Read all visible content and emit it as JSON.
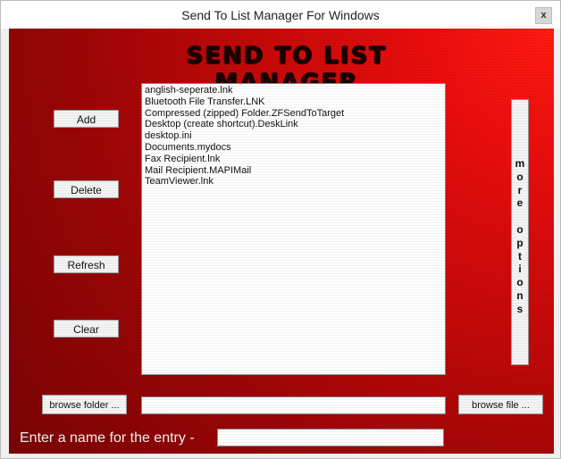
{
  "window": {
    "title": "Send To List Manager For Windows",
    "close_glyph": "x"
  },
  "banner": {
    "text": "SEND TO LIST MANAGER"
  },
  "buttons": {
    "add": "Add",
    "delete": "Delete",
    "refresh": "Refresh",
    "clear": "Clear",
    "browse_folder": "browse folder ...",
    "browse_file": "browse file ...",
    "more_options": [
      "m",
      "o",
      "r",
      "e",
      "",
      "o",
      "p",
      "t",
      "i",
      "o",
      "n",
      "s"
    ]
  },
  "list": {
    "items": [
      "anglish-seperate.lnk",
      "Bluetooth File Transfer.LNK",
      "Compressed (zipped) Folder.ZFSendToTarget",
      "Desktop (create shortcut).DeskLink",
      "desktop.ini",
      "Documents.mydocs",
      "Fax Recipient.lnk",
      "Mail Recipient.MAPIMail",
      "TeamViewer.lnk"
    ]
  },
  "inputs": {
    "path_value": "",
    "entry_name_value": ""
  },
  "labels": {
    "entry_name": "Enter a name for the entry -"
  },
  "colors": {
    "accent_red": "#c20808",
    "dark_red": "#7a0404"
  }
}
